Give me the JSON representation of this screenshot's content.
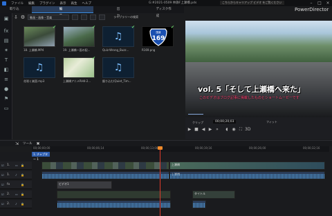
{
  "menu": {
    "items": [
      "ファイル",
      "編集",
      "プラグイン",
      "表示",
      "再生",
      "ヘルプ"
    ]
  },
  "file_title": "G:#2021-0509 林鉄F上瀬橋.pds",
  "notice": "こちらからキャリアップ ビデオ をご覧ください",
  "brand": "PowerDirector",
  "mode_tabs": [
    "取り込み",
    "編集",
    "出力",
    "ディスク作成"
  ],
  "library": {
    "filter": "動画・画像・音楽",
    "plugin_label": "ライブラリーの検索",
    "items": [
      {
        "caption": "18. 上瀬橋.MP4",
        "type": "video"
      },
      {
        "caption": "19. 上瀬橋一面の配...",
        "type": "video"
      },
      {
        "caption": "Quiz-Wrong_Buzz...",
        "type": "audio"
      },
      {
        "caption": "R169.png",
        "type": "image",
        "sign_top": "国道",
        "sign_num": "169"
      },
      {
        "caption": "花咲く楽園.mp3",
        "type": "audio"
      },
      {
        "caption": "上瀬橋アニメRH4-2...",
        "type": "image"
      },
      {
        "caption": "鍛り込む(Quiet_Tim...",
        "type": "audio"
      }
    ]
  },
  "preview": {
    "caption_main": "vol. 5「そして上瀬橋へ来た」",
    "caption_sub": "このビデオはブログ記事に掲載したものとショートムービーです",
    "clip_label": "クリップ",
    "timecode": "00;00;20;03",
    "fit": "フィット"
  },
  "timeline": {
    "tool_label": "ツール",
    "chapter": "1. チャプター 1",
    "ticks": [
      "00;00;00;00",
      "00;00;06;14",
      "00;00;13;00",
      "00;00;19;16",
      "00;00;26;00",
      "00;00;32;16",
      "00;00;39;00",
      "00;00;45;20"
    ],
    "tracks": [
      "1.",
      "1.",
      "fx",
      "2.",
      "2."
    ],
    "clip_labels": {
      "bottom_fx": "ビデオ1",
      "clip_a": "上瀬橋",
      "clip_b": "上瀬橋",
      "title_clip": "タイトル"
    }
  }
}
